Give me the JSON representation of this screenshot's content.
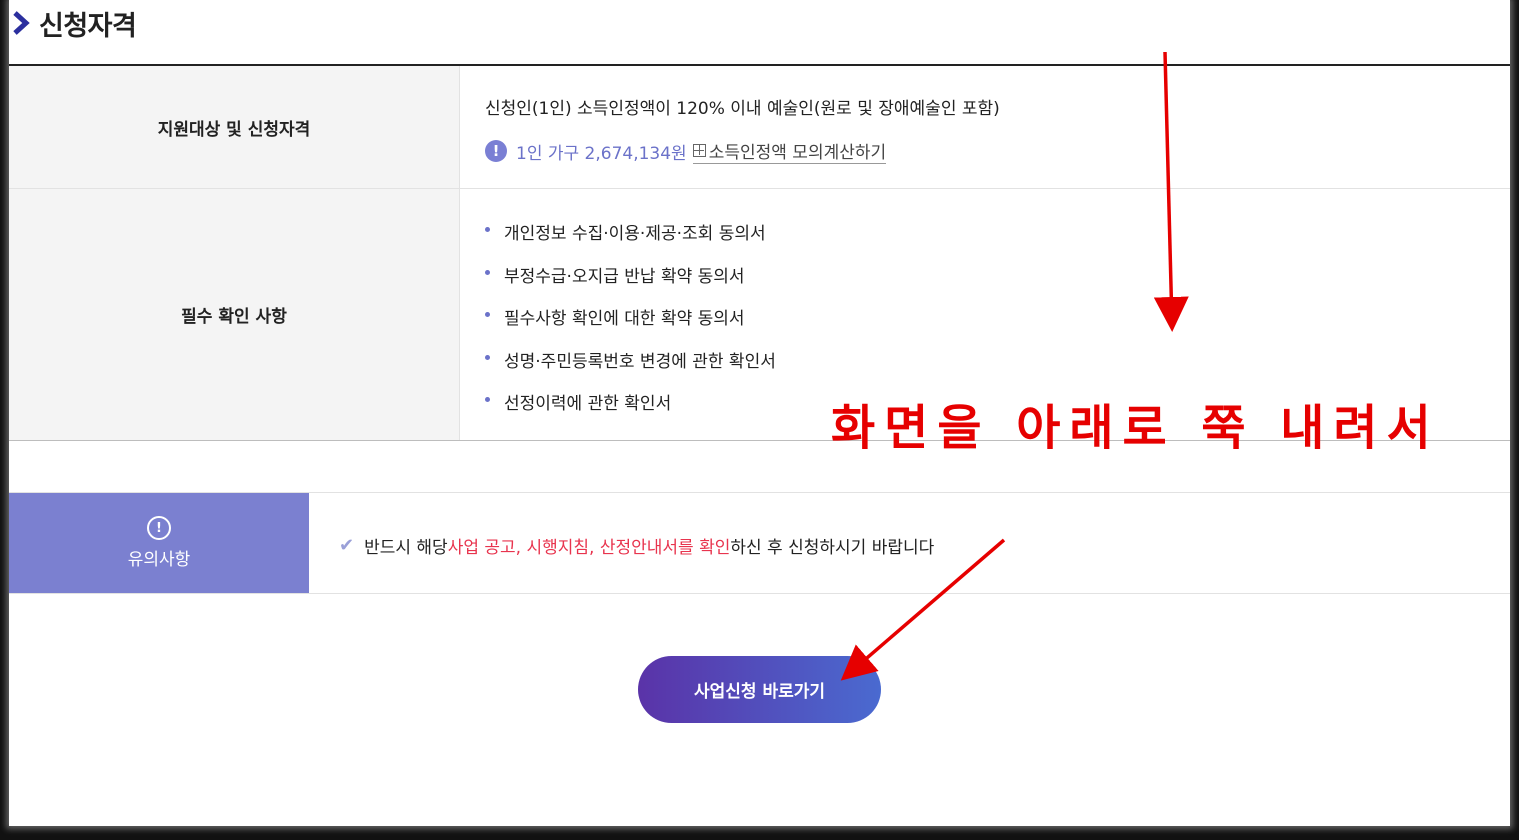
{
  "section": {
    "title": "신청자격"
  },
  "table": {
    "row1": {
      "header": "지원대상 및 신청자격",
      "main_text": "신청인(1인) 소득인정액이 120% 이내 예술인(원로 및 장애예술인 포함)",
      "info_icon": "!",
      "income_text": "1인 가구 2,674,134원",
      "calc_link": "소득인정액 모의계산하기"
    },
    "row2": {
      "header": "필수 확인 사항",
      "items": [
        "개인정보 수집·이용·제공·조회 동의서",
        "부정수급·오지급 반납 확약 동의서",
        "필수사항 확인에 대한 확약 동의서",
        "성명·주민등록번호 변경에 관한 확인서",
        "선정이력에 관한 확인서"
      ]
    }
  },
  "notice": {
    "icon": "!",
    "label": "유의사항",
    "text_before": "반드시 해당 ",
    "text_highlight": "사업 공고, 시행지침, 산정안내서를 확인",
    "text_after": "하신 후 신청하시기 바랍니다"
  },
  "button": {
    "label": "사업신청 바로가기"
  },
  "annotation": {
    "text": "화면을 아래로 쭉 내려서",
    "color": "#e60000"
  },
  "colors": {
    "accent": "#7b80d0",
    "highlight": "#e8344e",
    "info": "#6b72c9"
  }
}
